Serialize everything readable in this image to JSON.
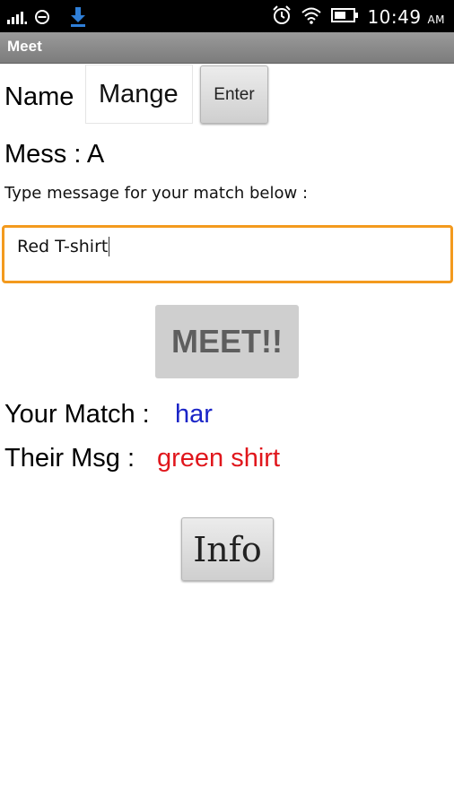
{
  "status_bar": {
    "time": "10:49",
    "ampm": "AM",
    "icons": [
      "signal-icon",
      "do-not-disturb-icon",
      "download-icon",
      "alarm-icon",
      "wifi-icon",
      "battery-icon"
    ]
  },
  "app": {
    "title": "Meet"
  },
  "form": {
    "name_label": "Name",
    "name_value": "Mange",
    "enter_label": "Enter",
    "mess_label": "Mess :  A",
    "prompt": "Type message for your match below :",
    "message_value": "Red T-shirt",
    "meet_label": "MEET!!"
  },
  "result": {
    "match_label": "Your Match :",
    "match_value": "har",
    "their_msg_label": "Their Msg :",
    "their_msg_value": "green shirt"
  },
  "info_label": "Info",
  "colors": {
    "accent_orange": "#f39a1e",
    "match_blue": "#1a24c7",
    "msg_red": "#e0161c"
  }
}
